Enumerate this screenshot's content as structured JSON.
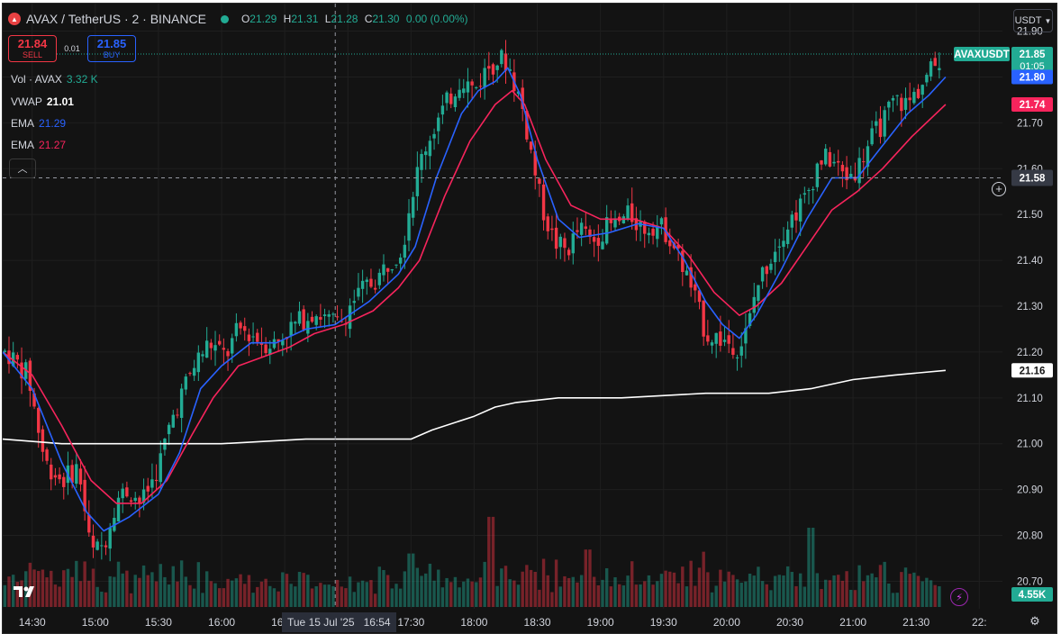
{
  "header": {
    "symbol": "AVAX / TetherUS · 2 · BINANCE",
    "logo_icon": "avax-logo-icon",
    "status_dot_color": "#22ab94",
    "open_label": "O",
    "open": "21.29",
    "high_label": "H",
    "high": "21.31",
    "low_label": "L",
    "low": "21.28",
    "close_label": "C",
    "close": "21.30",
    "change": "0.00 (0.00%)"
  },
  "trade": {
    "sell_price": "21.84",
    "sell_label": "SELL",
    "spread": "0.01",
    "buy_price": "21.85",
    "buy_label": "BUY"
  },
  "indicators": {
    "vol_label": "Vol · AVAX",
    "vol_value": "3.32 K",
    "vwap_label": "VWAP",
    "vwap_value": "21.01",
    "ema1_label": "EMA",
    "ema1_value": "21.29",
    "ema2_label": "EMA",
    "ema2_value": "21.27"
  },
  "currency_button": "USDT",
  "crosshair": {
    "time_label": "Tue 15 Jul '25",
    "time_value": "16:54",
    "price_label": "21.58"
  },
  "price_labels": {
    "symbol_tag": "AVAXUSDT",
    "last_price": "21.85",
    "countdown": "01:05",
    "ema_fast": "21.80",
    "ema_slow": "21.74",
    "vwap": "21.16",
    "volume": "4.55K"
  },
  "colors": {
    "background": "#131313",
    "up": "#22ab94",
    "down": "#f23645",
    "ema_fast": "#2962ff",
    "ema_slow": "#f7245c",
    "vwap": "#ffffff",
    "grid": "#1f1f1f"
  },
  "chart_data": {
    "type": "candlestick",
    "title": "AVAX / TetherUS · 2 · BINANCE",
    "y_ticks": [
      21.9,
      21.8,
      21.7,
      21.6,
      21.5,
      21.4,
      21.3,
      21.2,
      21.1,
      21.0,
      20.9,
      20.8,
      20.7
    ],
    "ylim": [
      20.64,
      21.96
    ],
    "x_ticks": [
      "14:30",
      "15:00",
      "15:30",
      "16:00",
      "16:30",
      "17:00",
      "17:30",
      "18:00",
      "18:30",
      "19:00",
      "19:30",
      "20:00",
      "20:30",
      "21:00",
      "21:30",
      "22:"
    ],
    "x_tick_minutes": [
      870,
      900,
      930,
      960,
      990,
      1020,
      1050,
      1080,
      1110,
      1140,
      1170,
      1200,
      1230,
      1260,
      1290,
      1320
    ],
    "xlim_minutes": [
      856,
      1331
    ],
    "candle_interval_minutes": 2,
    "crosshair_minutes": 1014,
    "grid": true,
    "price_path": [
      [
        858,
        21.2
      ],
      [
        868,
        21.15
      ],
      [
        876,
        20.96
      ],
      [
        884,
        20.92
      ],
      [
        892,
        20.95
      ],
      [
        898,
        20.76
      ],
      [
        904,
        20.78
      ],
      [
        910,
        20.88
      ],
      [
        916,
        20.9
      ],
      [
        922,
        20.87
      ],
      [
        930,
        20.95
      ],
      [
        936,
        21.05
      ],
      [
        942,
        21.12
      ],
      [
        948,
        21.18
      ],
      [
        954,
        21.22
      ],
      [
        962,
        21.19
      ],
      [
        968,
        21.25
      ],
      [
        974,
        21.24
      ],
      [
        980,
        21.22
      ],
      [
        986,
        21.22
      ],
      [
        992,
        21.25
      ],
      [
        998,
        21.27
      ],
      [
        1004,
        21.29
      ],
      [
        1010,
        21.27
      ],
      [
        1016,
        21.26
      ],
      [
        1022,
        21.31
      ],
      [
        1028,
        21.34
      ],
      [
        1034,
        21.36
      ],
      [
        1040,
        21.4
      ],
      [
        1046,
        21.43
      ],
      [
        1050,
        21.54
      ],
      [
        1056,
        21.64
      ],
      [
        1062,
        21.7
      ],
      [
        1068,
        21.75
      ],
      [
        1074,
        21.8
      ],
      [
        1080,
        21.77
      ],
      [
        1086,
        21.82
      ],
      [
        1092,
        21.84
      ],
      [
        1096,
        21.83
      ],
      [
        1098,
        21.8
      ],
      [
        1102,
        21.75
      ],
      [
        1106,
        21.66
      ],
      [
        1112,
        21.52
      ],
      [
        1118,
        21.44
      ],
      [
        1124,
        21.42
      ],
      [
        1130,
        21.47
      ],
      [
        1136,
        21.44
      ],
      [
        1142,
        21.47
      ],
      [
        1148,
        21.48
      ],
      [
        1154,
        21.5
      ],
      [
        1160,
        21.47
      ],
      [
        1166,
        21.48
      ],
      [
        1172,
        21.46
      ],
      [
        1178,
        21.4
      ],
      [
        1184,
        21.33
      ],
      [
        1190,
        21.24
      ],
      [
        1196,
        21.23
      ],
      [
        1202,
        21.22
      ],
      [
        1206,
        21.21
      ],
      [
        1210,
        21.25
      ],
      [
        1214,
        21.34
      ],
      [
        1220,
        21.4
      ],
      [
        1226,
        21.46
      ],
      [
        1232,
        21.5
      ],
      [
        1238,
        21.54
      ],
      [
        1244,
        21.62
      ],
      [
        1250,
        21.62
      ],
      [
        1256,
        21.58
      ],
      [
        1262,
        21.6
      ],
      [
        1268,
        21.66
      ],
      [
        1274,
        21.7
      ],
      [
        1280,
        21.75
      ],
      [
        1286,
        21.74
      ],
      [
        1292,
        21.78
      ],
      [
        1298,
        21.82
      ],
      [
        1302,
        21.85
      ]
    ],
    "ema_fast_path": [
      [
        856,
        21.2
      ],
      [
        870,
        21.12
      ],
      [
        884,
        20.96
      ],
      [
        896,
        20.85
      ],
      [
        904,
        20.81
      ],
      [
        916,
        20.84
      ],
      [
        930,
        20.89
      ],
      [
        940,
        20.98
      ],
      [
        950,
        21.12
      ],
      [
        960,
        21.17
      ],
      [
        974,
        21.22
      ],
      [
        986,
        21.22
      ],
      [
        1000,
        21.25
      ],
      [
        1014,
        21.26
      ],
      [
        1030,
        21.31
      ],
      [
        1044,
        21.37
      ],
      [
        1052,
        21.43
      ],
      [
        1062,
        21.58
      ],
      [
        1074,
        21.72
      ],
      [
        1082,
        21.77
      ],
      [
        1090,
        21.79
      ],
      [
        1096,
        21.82
      ],
      [
        1102,
        21.76
      ],
      [
        1110,
        21.62
      ],
      [
        1120,
        21.49
      ],
      [
        1130,
        21.45
      ],
      [
        1144,
        21.46
      ],
      [
        1158,
        21.48
      ],
      [
        1170,
        21.47
      ],
      [
        1180,
        21.4
      ],
      [
        1190,
        21.31
      ],
      [
        1198,
        21.26
      ],
      [
        1206,
        21.23
      ],
      [
        1214,
        21.28
      ],
      [
        1226,
        21.38
      ],
      [
        1238,
        21.49
      ],
      [
        1250,
        21.58
      ],
      [
        1262,
        21.58
      ],
      [
        1274,
        21.65
      ],
      [
        1286,
        21.72
      ],
      [
        1296,
        21.76
      ],
      [
        1304,
        21.8
      ]
    ],
    "ema_slow_path": [
      [
        856,
        21.2
      ],
      [
        870,
        21.15
      ],
      [
        884,
        21.04
      ],
      [
        898,
        20.92
      ],
      [
        910,
        20.87
      ],
      [
        922,
        20.87
      ],
      [
        934,
        20.92
      ],
      [
        946,
        21.02
      ],
      [
        956,
        21.1
      ],
      [
        968,
        21.17
      ],
      [
        980,
        21.19
      ],
      [
        992,
        21.21
      ],
      [
        1004,
        21.24
      ],
      [
        1018,
        21.26
      ],
      [
        1032,
        21.29
      ],
      [
        1044,
        21.34
      ],
      [
        1054,
        21.4
      ],
      [
        1066,
        21.54
      ],
      [
        1078,
        21.66
      ],
      [
        1090,
        21.74
      ],
      [
        1098,
        21.77
      ],
      [
        1104,
        21.74
      ],
      [
        1114,
        21.62
      ],
      [
        1126,
        21.52
      ],
      [
        1140,
        21.49
      ],
      [
        1156,
        21.49
      ],
      [
        1170,
        21.47
      ],
      [
        1182,
        21.41
      ],
      [
        1194,
        21.33
      ],
      [
        1206,
        21.28
      ],
      [
        1214,
        21.3
      ],
      [
        1226,
        21.35
      ],
      [
        1238,
        21.43
      ],
      [
        1250,
        21.51
      ],
      [
        1262,
        21.55
      ],
      [
        1274,
        21.6
      ],
      [
        1288,
        21.67
      ],
      [
        1304,
        21.74
      ]
    ],
    "vwap_path": [
      [
        856,
        21.01
      ],
      [
        884,
        21.0
      ],
      [
        920,
        21.0
      ],
      [
        960,
        21.0
      ],
      [
        1000,
        21.01
      ],
      [
        1050,
        21.01
      ],
      [
        1060,
        21.03
      ],
      [
        1080,
        21.06
      ],
      [
        1090,
        21.08
      ],
      [
        1100,
        21.09
      ],
      [
        1120,
        21.1
      ],
      [
        1150,
        21.1
      ],
      [
        1190,
        21.11
      ],
      [
        1220,
        21.11
      ],
      [
        1240,
        21.12
      ],
      [
        1260,
        21.14
      ],
      [
        1280,
        21.15
      ],
      [
        1304,
        21.16
      ]
    ],
    "volume_spikes": [
      [
        1088,
        4.55
      ],
      [
        1240,
        4.0
      ],
      [
        1050,
        2.7
      ],
      [
        1134,
        2.9
      ]
    ]
  }
}
